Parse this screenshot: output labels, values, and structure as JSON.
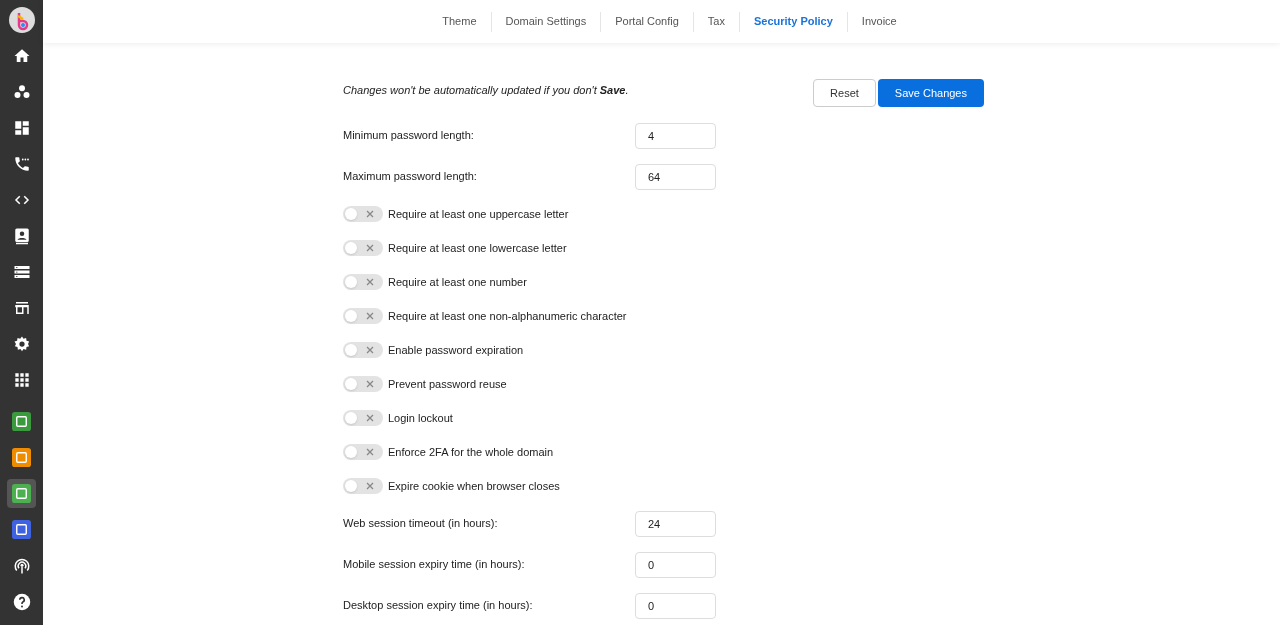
{
  "sidebar": {
    "items": [
      {
        "kind": "logo",
        "selected": false
      },
      {
        "kind": "home",
        "selected": false
      },
      {
        "kind": "users",
        "selected": false
      },
      {
        "kind": "dashboard",
        "selected": false
      },
      {
        "kind": "phone",
        "selected": false
      },
      {
        "kind": "code",
        "selected": false
      },
      {
        "kind": "contact",
        "selected": false
      },
      {
        "kind": "list",
        "selected": false
      },
      {
        "kind": "store",
        "selected": false
      },
      {
        "kind": "settings",
        "selected": false
      },
      {
        "kind": "grid",
        "selected": false
      },
      {
        "kind": "app",
        "selected": false,
        "color": "#3c9a3e"
      },
      {
        "kind": "app",
        "selected": false,
        "color": "#f08c00"
      },
      {
        "kind": "app",
        "selected": true,
        "color": "#4caf50"
      },
      {
        "kind": "app",
        "selected": false,
        "color": "#3f63e0"
      },
      {
        "kind": "broadcast",
        "selected": false
      },
      {
        "kind": "help",
        "selected": false
      }
    ]
  },
  "tabs": [
    {
      "label": "Theme",
      "selected": false
    },
    {
      "label": "Domain Settings",
      "selected": false
    },
    {
      "label": "Portal Config",
      "selected": false
    },
    {
      "label": "Tax",
      "selected": false
    },
    {
      "label": "Security Policy",
      "selected": true
    },
    {
      "label": "Invoice",
      "selected": false
    }
  ],
  "notice": "Changes won't be automatically updated if you don't **Save**.",
  "buttons": [
    {
      "label": "Reset",
      "kind": "secondary"
    },
    {
      "label": "Save Changes",
      "kind": "primary"
    }
  ],
  "settings": [
    {
      "kind": "number",
      "label": "Minimum password length:",
      "value": "4"
    },
    {
      "kind": "number",
      "label": "Maximum password length:",
      "value": "64"
    },
    {
      "kind": "toggle",
      "label": "Require at least one uppercase letter",
      "on": false
    },
    {
      "kind": "toggle",
      "label": "Require at least one lowercase letter",
      "on": false
    },
    {
      "kind": "toggle",
      "label": "Require at least one number",
      "on": false
    },
    {
      "kind": "toggle",
      "label": "Require at least one non-alphanumeric character",
      "on": false
    },
    {
      "kind": "toggle",
      "label": "Enable password expiration",
      "on": false
    },
    {
      "kind": "toggle",
      "label": "Prevent password reuse",
      "on": false
    },
    {
      "kind": "toggle",
      "label": "Login lockout",
      "on": false
    },
    {
      "kind": "toggle",
      "label": "Enforce 2FA for the whole domain",
      "on": false
    },
    {
      "kind": "toggle",
      "label": "Expire cookie when browser closes",
      "on": false
    },
    {
      "kind": "number",
      "label": "Web session timeout (in hours):",
      "value": "24"
    },
    {
      "kind": "number",
      "label": "Mobile session expiry time (in hours):",
      "value": "0"
    },
    {
      "kind": "number",
      "label": "Desktop session expiry time (in hours):",
      "value": "0"
    }
  ]
}
